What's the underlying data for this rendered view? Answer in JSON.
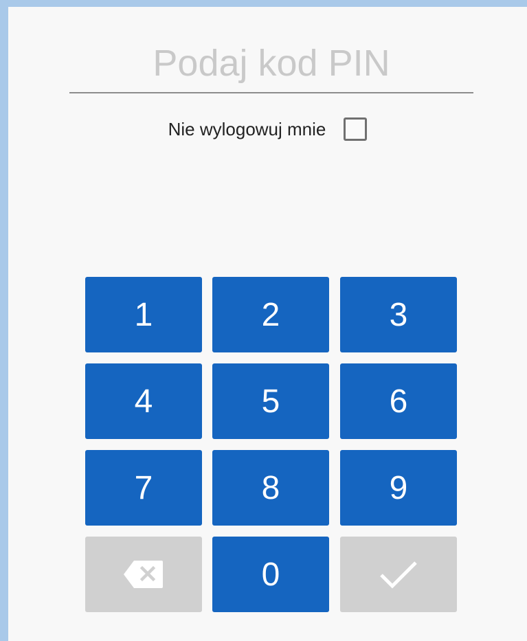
{
  "pin": {
    "value": "",
    "placeholder": "Podaj kod PIN"
  },
  "remember": {
    "label": "Nie wylogowuj mnie",
    "checked": false
  },
  "keypad": {
    "keys": [
      "1",
      "2",
      "3",
      "4",
      "5",
      "6",
      "7",
      "8",
      "9",
      "0"
    ],
    "backspace_icon": "backspace-icon",
    "confirm_icon": "checkmark-icon"
  },
  "colors": {
    "key_active": "#1565c0",
    "key_disabled": "#d0d0d0",
    "background": "#f8f8f8",
    "window_border": "#a9c9e9"
  }
}
